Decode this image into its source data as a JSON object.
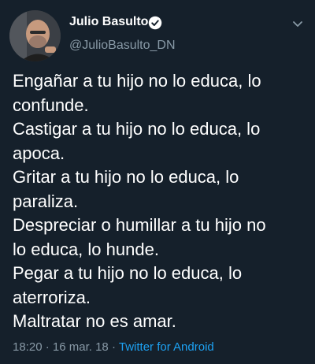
{
  "author": {
    "display_name": "Julio Basulto",
    "handle": "@JulioBasulto_DN",
    "verified": true
  },
  "tweet": {
    "lines": [
      "Engañar a tu hijo no lo educa, lo",
      "confunde.",
      "Castigar a tu hijo no lo educa, lo",
      "apoca.",
      "Gritar a tu hijo no lo educa, lo",
      "paraliza.",
      "Despreciar o humillar a tu hijo no",
      "lo educa, lo hunde.",
      "Pegar a tu hijo no lo educa, lo",
      "aterroriza.",
      "Maltratar no es amar."
    ]
  },
  "meta": {
    "time": "18:20",
    "separator": "·",
    "date": "16 mar. 18",
    "source": "Twitter for Android"
  },
  "icons": {
    "verified": "verified-badge-icon",
    "menu": "chevron-down-icon"
  },
  "colors": {
    "background": "#15202b",
    "text": "#ffffff",
    "secondary": "#8899a6",
    "link": "#1da1f2"
  }
}
